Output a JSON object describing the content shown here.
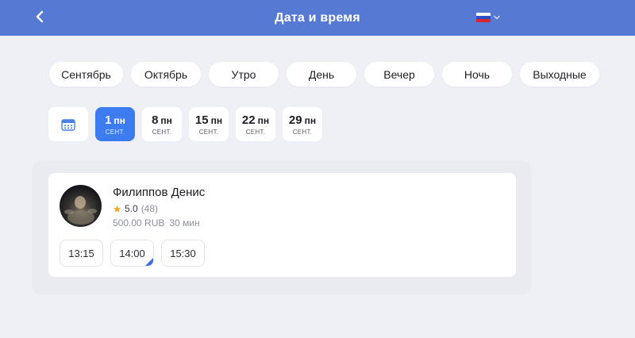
{
  "header": {
    "title": "Дата и время",
    "back_icon": "chevron-left-icon",
    "language": {
      "icon": "russian-flag-icon",
      "dropdown_icon": "chevron-down-icon"
    }
  },
  "filters": [
    {
      "label": "Сентябрь"
    },
    {
      "label": "Октябрь"
    },
    {
      "label": "Утро"
    },
    {
      "label": "День"
    },
    {
      "label": "Вечер"
    },
    {
      "label": "Ночь"
    },
    {
      "label": "Выходные"
    }
  ],
  "dates": {
    "calendar_icon": "calendar-icon",
    "days": [
      {
        "num": "1",
        "weekday": "пн",
        "month": "СЕНТ.",
        "selected": true
      },
      {
        "num": "8",
        "weekday": "пн",
        "month": "СЕНТ.",
        "selected": false
      },
      {
        "num": "15",
        "weekday": "пн",
        "month": "СЕНТ.",
        "selected": false
      },
      {
        "num": "22",
        "weekday": "пн",
        "month": "СЕНТ.",
        "selected": false
      },
      {
        "num": "29",
        "weekday": "пн",
        "month": "СЕНТ.",
        "selected": false
      }
    ]
  },
  "specialist": {
    "name": "Филиппов Денис",
    "rating": "5.0",
    "reviews": "(48)",
    "price": "500.00 RUB",
    "duration": "30 мин",
    "slots": [
      {
        "time": "13:15",
        "marked": false
      },
      {
        "time": "14:00",
        "marked": true
      },
      {
        "time": "15:30",
        "marked": false
      }
    ]
  },
  "colors": {
    "header": "#567ad4",
    "accent": "#3d7bf0",
    "star": "#f5a623",
    "background": "#eef0f5"
  }
}
